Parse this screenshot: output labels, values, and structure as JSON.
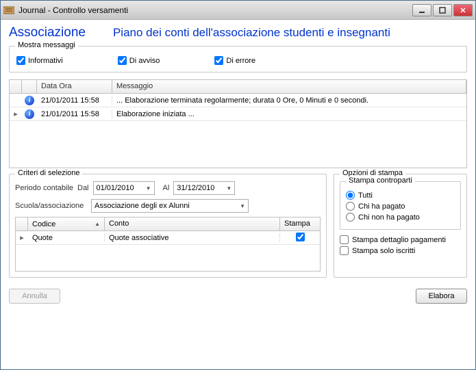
{
  "window": {
    "title": "Journal - Controllo versamenti"
  },
  "header": {
    "assoc_label": "Associazione",
    "plan_label": "Piano dei conti dell'associazione studenti e insegnanti"
  },
  "messages": {
    "group_title": "Mostra messaggi",
    "chk_info": "Informativi",
    "chk_warn": "Di avviso",
    "chk_err": "Di errore",
    "col_datetime": "Data Ora",
    "col_message": "Messaggio",
    "rows": [
      {
        "datetime": "21/01/2011 15:58",
        "text": "... Elaborazione terminata regolarmente; durata 0 Ore, 0 Minuti e 0 secondi."
      },
      {
        "datetime": "21/01/2011 15:58",
        "text": "Elaborazione iniziata ..."
      }
    ]
  },
  "criteria": {
    "group_title": "Criteri di selezione",
    "period_label": "Periodo contabile",
    "from_label": "Dal",
    "from_value": "01/01/2010",
    "to_label": "Al",
    "to_value": "31/12/2010",
    "school_label": "Scuola/associazione",
    "school_value": "Associazione degli ex Alunni",
    "col_code": "Codice",
    "col_account": "Conto",
    "col_print": "Stampa",
    "rows": [
      {
        "code": "Quote",
        "account": "Quote associative",
        "print": true
      }
    ]
  },
  "print_opts": {
    "group_title": "Opzioni di stampa",
    "counterparts_title": "Stampa controparti",
    "radio_all": "Tutti",
    "radio_paid": "Chi ha pagato",
    "radio_unpaid": "Chi non ha pagato",
    "chk_detail": "Stampa dettaglio pagamenti",
    "chk_enrolled": "Stampa solo iscritti"
  },
  "footer": {
    "cancel": "Annulla",
    "process": "Elabora"
  }
}
